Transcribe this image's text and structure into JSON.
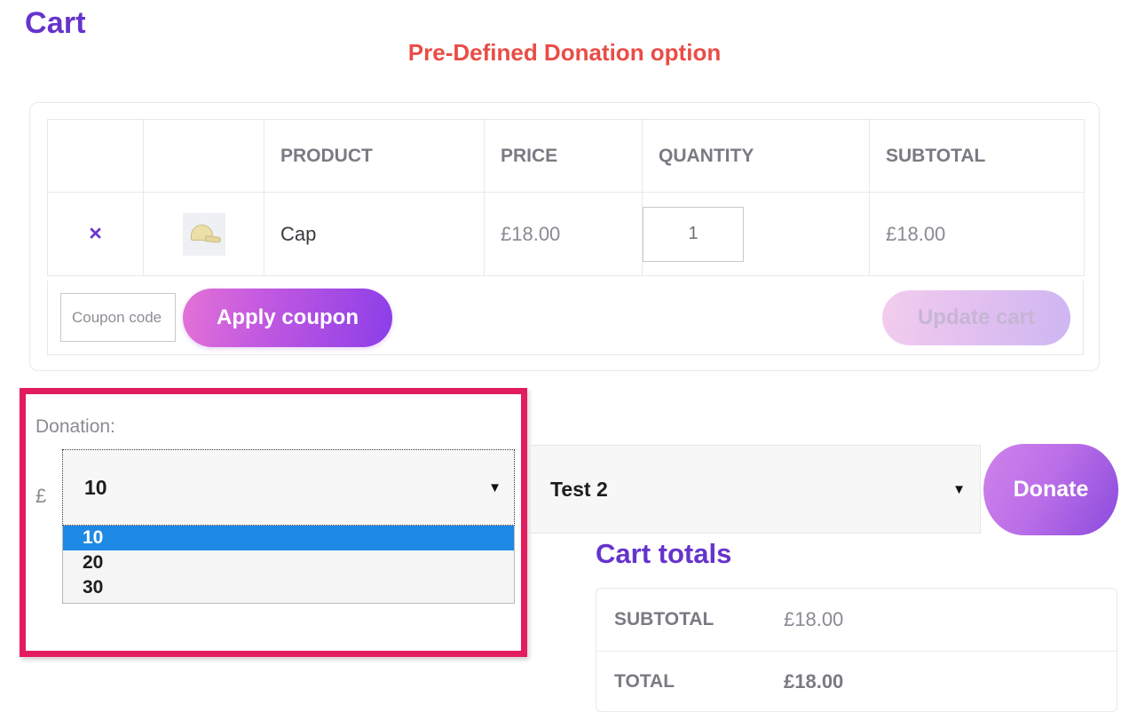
{
  "page": {
    "cart_title": "Cart",
    "section_title": "Pre-Defined Donation option"
  },
  "cart_table": {
    "headers": [
      "",
      "",
      "PRODUCT",
      "PRICE",
      "QUANTITY",
      "SUBTOTAL"
    ],
    "rows": [
      {
        "remove_icon": "×",
        "thumb_alt": "cap-thumbnail",
        "product": "Cap",
        "price": "£18.00",
        "quantity": "1",
        "subtotal": "£18.00"
      }
    ]
  },
  "coupon": {
    "placeholder": "Coupon code",
    "value": "",
    "apply_label": "Apply coupon",
    "update_label": "Update cart"
  },
  "donation": {
    "label": "Donation:",
    "currency": "£",
    "amount_selected": "10",
    "amount_options": [
      "10",
      "20",
      "30"
    ],
    "highlighted_option_index": 0,
    "cause_selected": "Test 2",
    "donate_label": "Donate",
    "caret_glyph": "▼",
    "highlight_color": "#e31c5f",
    "highlight_option_bg": "#1e88e5"
  },
  "totals": {
    "title": "Cart totals",
    "rows": [
      {
        "label": "SUBTOTAL",
        "value": "£18.00"
      },
      {
        "label": "TOTAL",
        "value": "£18.00"
      }
    ]
  },
  "theme": {
    "title_color": "#6633cc",
    "section_title_color": "#ea4c46"
  }
}
